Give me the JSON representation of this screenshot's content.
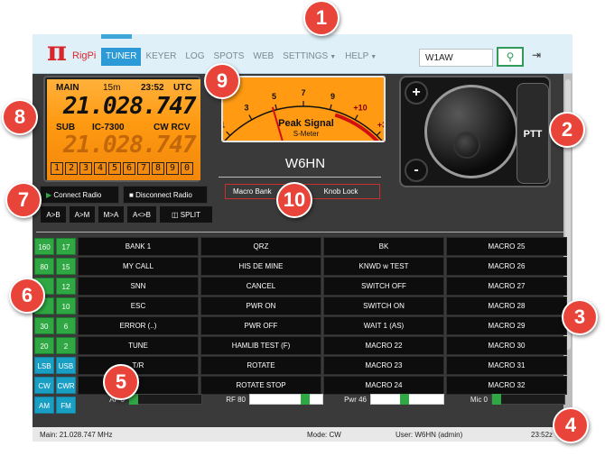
{
  "app": {
    "brand": "RigPi",
    "nav": [
      {
        "label": "TUNER",
        "active": true
      },
      {
        "label": "KEYER"
      },
      {
        "label": "LOG"
      },
      {
        "label": "SPOTS"
      },
      {
        "label": "WEB"
      },
      {
        "label": "SETTINGS",
        "dropdown": true
      },
      {
        "label": "HELP",
        "dropdown": true
      }
    ],
    "search": {
      "value": "W1AW"
    }
  },
  "radio": {
    "main_label": "MAIN",
    "band": "15m",
    "time": "23:52",
    "time_zone": "UTC",
    "main_freq": "21.028.747",
    "sub_label": "SUB",
    "model": "IC-7300",
    "mode": "CW RCV",
    "sub_freq": "21.028.747",
    "digits": [
      "1",
      "2",
      "3",
      "4",
      "5",
      "6",
      "7",
      "8",
      "9",
      "0"
    ]
  },
  "meter": {
    "scale": [
      "S",
      "1",
      "3",
      "5",
      "7",
      "9",
      "+10",
      "+30",
      "+60"
    ],
    "title": "Peak Signal",
    "subtitle": "S-Meter",
    "needle_level": 0.36
  },
  "callsign": "W6HN",
  "controls": {
    "connect": "Connect Radio",
    "disconnect": "Disconnect Radio",
    "buttons": [
      "A>B",
      "A>M",
      "M>A",
      "A<>B"
    ],
    "split": "SPLIT",
    "macro_bank": "Macro Bank",
    "knob_lock": "Knob Lock"
  },
  "knob": {
    "plus": "+",
    "minus": "-",
    "ptt": "PTT"
  },
  "bands": [
    [
      "160",
      "17"
    ],
    [
      "80",
      "15"
    ],
    [
      "",
      "12"
    ],
    [
      "",
      "10"
    ],
    [
      "30",
      "6"
    ],
    [
      "20",
      "2"
    ],
    [
      "LSB",
      "USB"
    ],
    [
      "CW",
      "CWR"
    ],
    [
      "AM",
      "FM"
    ]
  ],
  "macros": [
    [
      "BANK 1",
      "QRZ",
      "BK",
      "MACRO 25"
    ],
    [
      "MY CALL",
      "HIS DE MINE",
      "KNWD w TEST",
      "MACRO 26"
    ],
    [
      "SNN",
      "CANCEL",
      "SWITCH OFF",
      "MACRO 27"
    ],
    [
      "ESC",
      "PWR ON",
      "SWITCH ON",
      "MACRO 28"
    ],
    [
      "ERROR (..)",
      "PWR OFF",
      "WAIT 1 (AS)",
      "MACRO 29"
    ],
    [
      "TUNE",
      "HAMLIB TEST (F)",
      "MACRO 22",
      "MACRO 30"
    ],
    [
      "T/R",
      "ROTATE",
      "MACRO 23",
      "MACRO 31"
    ],
    [
      "",
      "ROTATE STOP",
      "MACRO 24",
      "MACRO 32"
    ]
  ],
  "sliders": [
    {
      "label": "AF 0",
      "level": 0.0
    },
    {
      "label": "RF 80",
      "level": 0.8
    },
    {
      "label": "Pwr 46",
      "level": 0.46
    },
    {
      "label": "Mic 0",
      "level": 0.0
    }
  ],
  "status": {
    "main": "Main: 21.028.747 MHz",
    "mode": "Mode: CW",
    "user": "User: W6HN (admin)",
    "clock": "23:52z"
  },
  "callouts": [
    "1",
    "2",
    "3",
    "4",
    "5",
    "6",
    "7",
    "8",
    "9",
    "10"
  ],
  "colors": {
    "accent": "#2b9ad6",
    "band_green": "#2fa844",
    "mode_blue": "#1a9fc4",
    "lcd_orange": "#ff9a12",
    "callout_red": "#e8443a"
  }
}
